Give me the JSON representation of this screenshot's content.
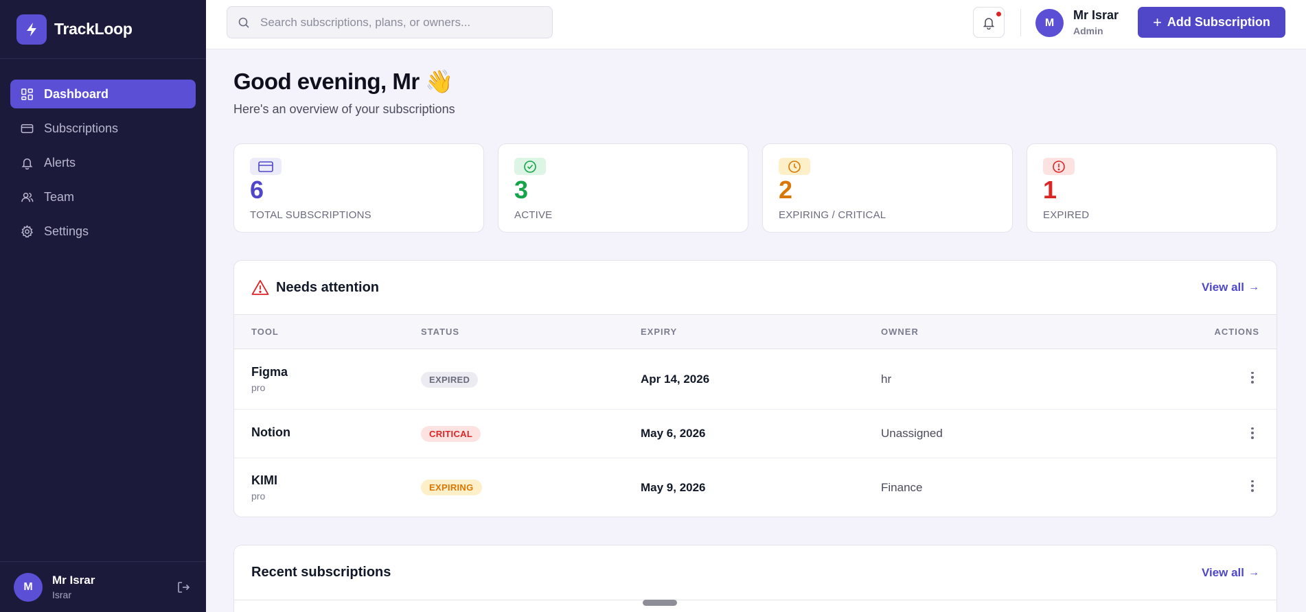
{
  "brand": {
    "name": "TrackLoop"
  },
  "sidebar": {
    "items": [
      {
        "label": "Dashboard",
        "icon": "grid-icon",
        "active": true
      },
      {
        "label": "Subscriptions",
        "icon": "card-icon"
      },
      {
        "label": "Alerts",
        "icon": "bell-icon"
      },
      {
        "label": "Team",
        "icon": "users-icon"
      },
      {
        "label": "Settings",
        "icon": "gear-icon"
      }
    ],
    "user": {
      "avatar": "M",
      "name": "Mr Israr",
      "sub": "Israr"
    }
  },
  "topbar": {
    "search_placeholder": "Search subscriptions, plans, or owners...",
    "user": {
      "avatar": "M",
      "name": "Mr Israr",
      "role": "Admin"
    },
    "add_label": "Add Subscription"
  },
  "greeting": {
    "title": "Good evening, Mr 👋",
    "subtitle": "Here's an overview of your subscriptions"
  },
  "stats": [
    {
      "value": "6",
      "label": "TOTAL SUBSCRIPTIONS",
      "color": "#4f46c8",
      "bg": "#ecebfa"
    },
    {
      "value": "3",
      "label": "ACTIVE",
      "color": "#16a34a",
      "bg": "#dcf5e4"
    },
    {
      "value": "2",
      "label": "EXPIRING / CRITICAL",
      "color": "#d97706",
      "bg": "#fdefc8"
    },
    {
      "value": "1",
      "label": "EXPIRED",
      "color": "#dc2626",
      "bg": "#fde2e2"
    }
  ],
  "attention": {
    "title": "Needs attention",
    "view_all": "View all",
    "columns": [
      "TOOL",
      "STATUS",
      "EXPIRY",
      "OWNER",
      "ACTIONS"
    ],
    "rows": [
      {
        "tool": "Figma",
        "plan": "pro",
        "status": "EXPIRED",
        "expiry": "Apr 14, 2026",
        "owner": "hr"
      },
      {
        "tool": "Notion",
        "plan": "",
        "status": "CRITICAL",
        "expiry": "May 6, 2026",
        "owner": "Unassigned"
      },
      {
        "tool": "KIMI",
        "plan": "pro",
        "status": "EXPIRING",
        "expiry": "May 9, 2026",
        "owner": "Finance"
      }
    ]
  },
  "recent": {
    "title": "Recent subscriptions",
    "view_all": "View all"
  },
  "status_colors": {
    "EXPIRED": {
      "bg": "#ebebf1",
      "fg": "#6b6b7e"
    },
    "CRITICAL": {
      "bg": "#fde2e2",
      "fg": "#dc2626"
    },
    "EXPIRING": {
      "bg": "#fdefc8",
      "fg": "#d97706"
    }
  }
}
